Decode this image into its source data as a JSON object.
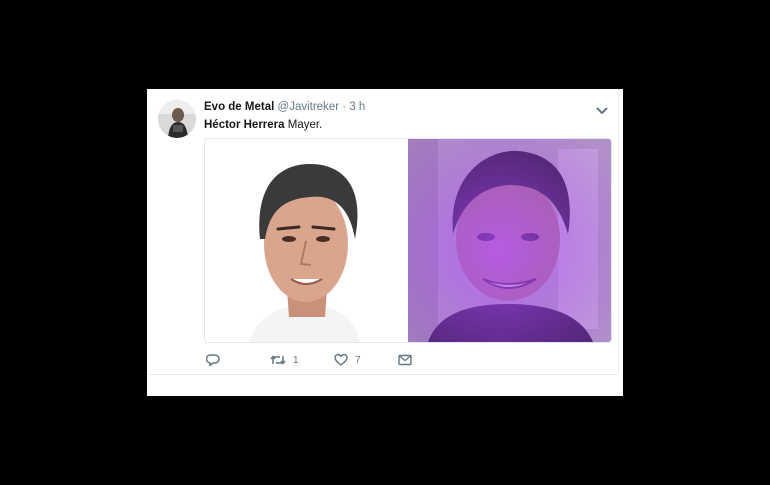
{
  "tweet": {
    "display_name": "Evo de Metal",
    "handle": "@Javitreker",
    "separator": "·",
    "time": "3 h",
    "text_mention": "Héctor Herrera",
    "text_rest": " Mayer."
  },
  "actions": {
    "reply_icon": "reply-icon",
    "retweet_icon": "retweet-icon",
    "retweet_count": "1",
    "like_icon": "heart-icon",
    "like_count": "7",
    "dm_icon": "envelope-icon"
  },
  "colors": {
    "text_primary": "#14171a",
    "text_secondary": "#657786",
    "border": "#e1e8ed",
    "purple_filter": "#a43bff"
  }
}
